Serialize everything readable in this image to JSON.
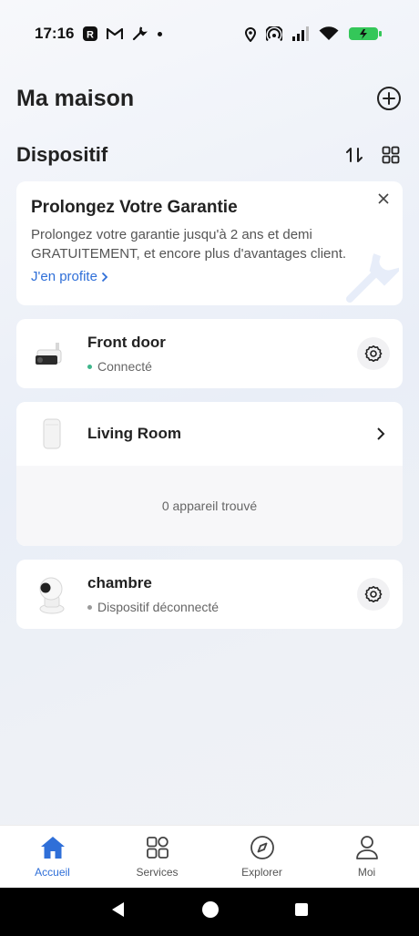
{
  "status_bar": {
    "time": "17:16",
    "left_icons": [
      "r-app-icon",
      "gmail-icon",
      "wrench-icon",
      "dot"
    ],
    "right_icons": [
      "location-icon",
      "hotspot-icon",
      "signal-icon",
      "wifi-icon",
      "battery-icon"
    ],
    "battery_color": "#34c759"
  },
  "header": {
    "title": "Ma maison",
    "add_icon": "add-circle-icon"
  },
  "devices_section": {
    "title": "Dispositif",
    "sort_icon": "sort-icon",
    "grid_icon": "grid-view-icon"
  },
  "promo": {
    "title": "Prolongez Votre Garantie",
    "text": "Prolongez votre garantie jusqu'à 2 ans et demi GRATUITEMENT,  et encore plus d'avantages client.",
    "link": "J'en profite"
  },
  "devices": [
    {
      "name": "Front door",
      "status": "Connecté",
      "status_color": "#3fb68b",
      "icon": "outdoor-camera-icon"
    },
    {
      "name": "chambre",
      "status": "Dispositif déconnecté",
      "status_color": "#9a9a9a",
      "icon": "indoor-camera-icon"
    }
  ],
  "room": {
    "name": "Living Room",
    "empty_text": "0 appareil trouvé",
    "icon": "hub-icon"
  },
  "tabs": [
    {
      "label": "Accueil",
      "icon": "home-icon",
      "active": true
    },
    {
      "label": "Services",
      "icon": "services-icon",
      "active": false
    },
    {
      "label": "Explorer",
      "icon": "compass-icon",
      "active": false
    },
    {
      "label": "Moi",
      "icon": "user-icon",
      "active": false
    }
  ],
  "colors": {
    "accent": "#2f6fd8"
  }
}
